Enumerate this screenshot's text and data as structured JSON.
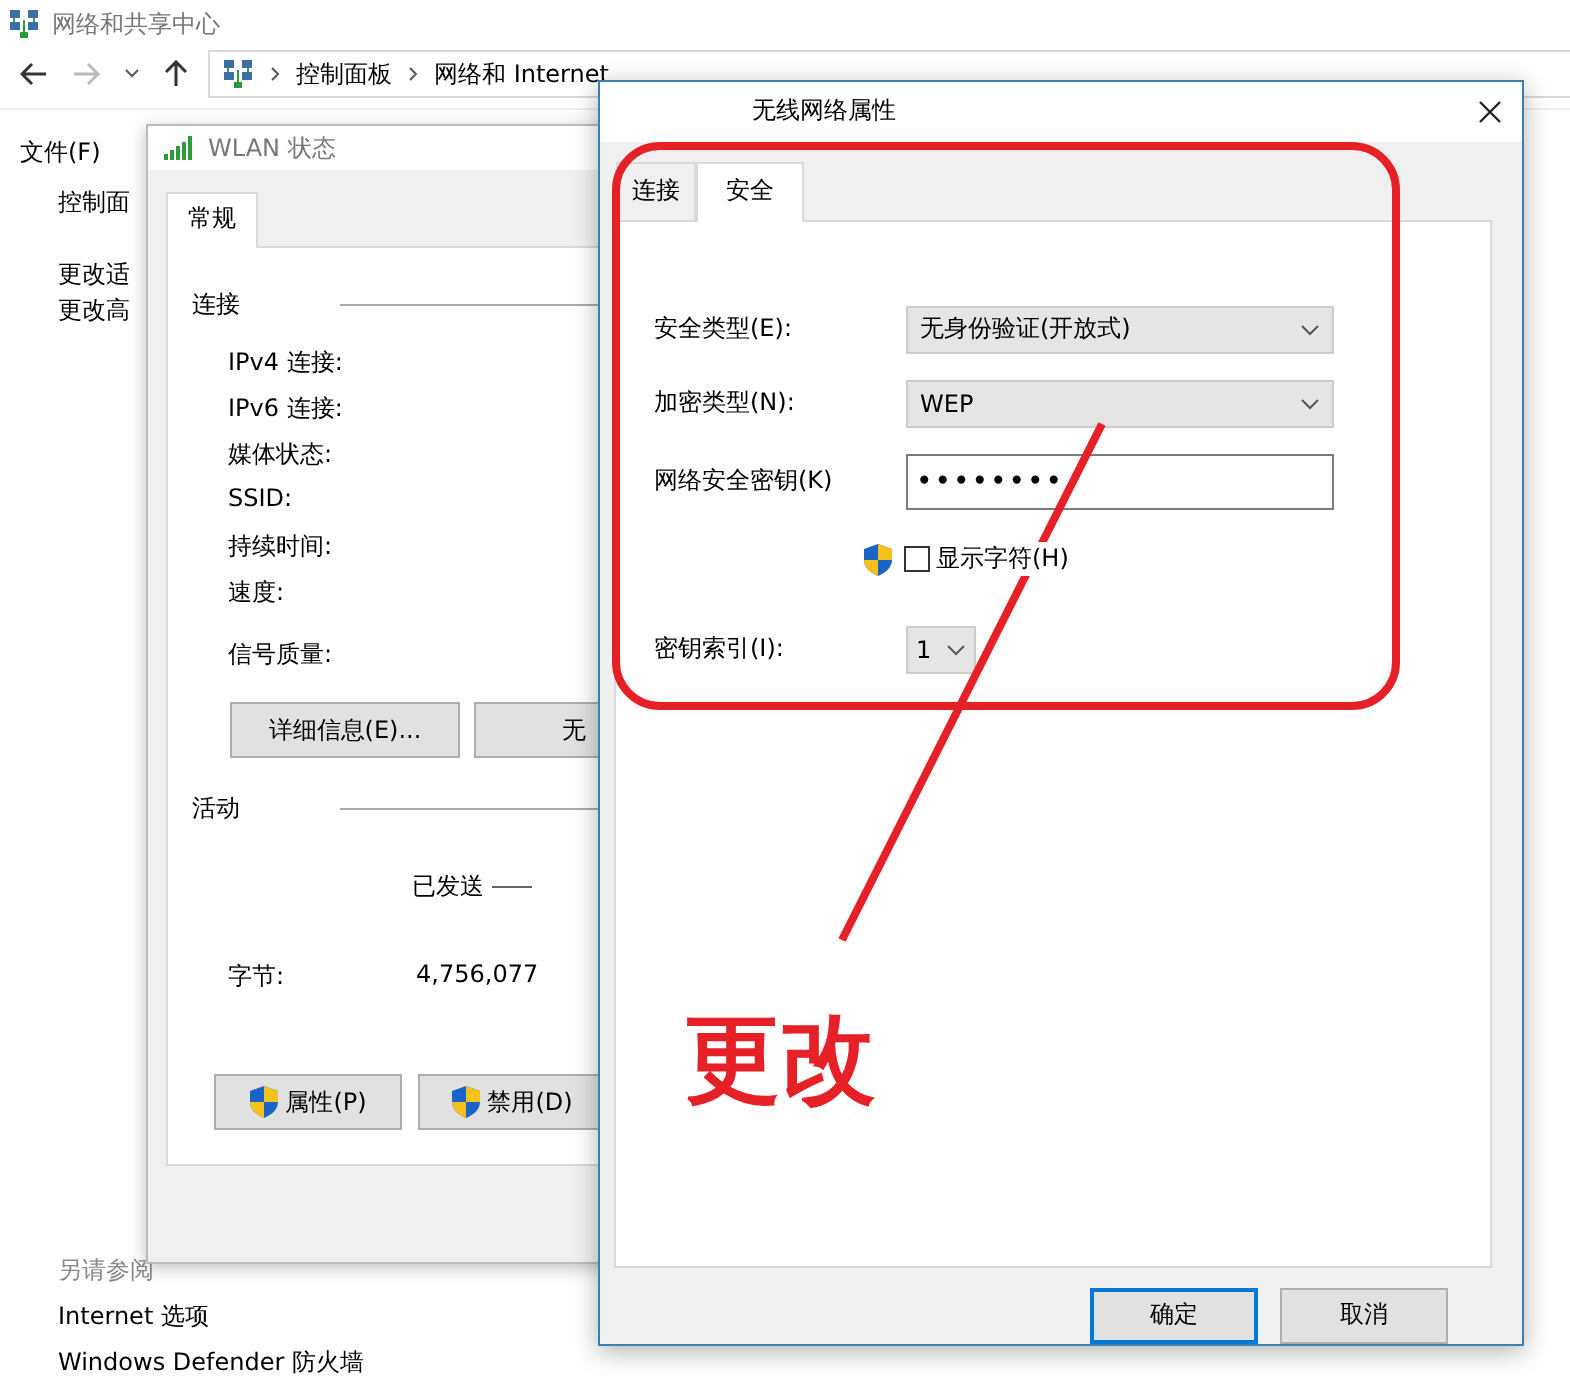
{
  "background_window": {
    "title": "网络和共享中心",
    "breadcrumb": [
      "控制面板",
      "网络和 Internet"
    ],
    "menu": [
      "文件(F)"
    ],
    "sidebar_links": [
      "控制面",
      "更改适",
      "更改高"
    ],
    "see_also": {
      "heading": "另请参阅",
      "links": [
        "Internet 选项",
        "Windows Defender 防火墙"
      ]
    }
  },
  "status_window": {
    "title": "WLAN 状态",
    "tabs": [
      {
        "label": "常规",
        "selected": true
      }
    ],
    "connection": {
      "heading": "连接",
      "fields": [
        "IPv4 连接:",
        "IPv6 连接:",
        "媒体状态:",
        "SSID:",
        "持续时间:",
        "速度:",
        "信号质量:"
      ]
    },
    "buttons": [
      "详细信息(E)...",
      "无"
    ],
    "activity": {
      "heading": "活动",
      "sent_label": "已发送",
      "bytes_label": "字节:",
      "bytes_sent": "4,756,077"
    },
    "footer_buttons": [
      "属性(P)",
      "禁用(D)"
    ]
  },
  "properties_dialog": {
    "title": "无线网络属性",
    "tabs": [
      {
        "label": "连接",
        "selected": false
      },
      {
        "label": "安全",
        "selected": true
      }
    ],
    "fields": [
      {
        "kind": "dropdown",
        "label": "安全类型(E):",
        "value": "无身份验证(开放式)"
      },
      {
        "kind": "dropdown",
        "label": "加密类型(N):",
        "value": "WEP"
      },
      {
        "kind": "password",
        "label": "网络安全密钥(K)",
        "value": "••••••••"
      },
      {
        "kind": "checkbox",
        "label": "显示字符(H)",
        "checked": false
      },
      {
        "kind": "small_dropdown",
        "label": "密钥索引(I):",
        "value": "1"
      }
    ],
    "buttons": [
      {
        "label": "确定",
        "default": true
      },
      {
        "label": "取消",
        "default": false
      }
    ]
  },
  "annotation": {
    "label": "更改"
  }
}
